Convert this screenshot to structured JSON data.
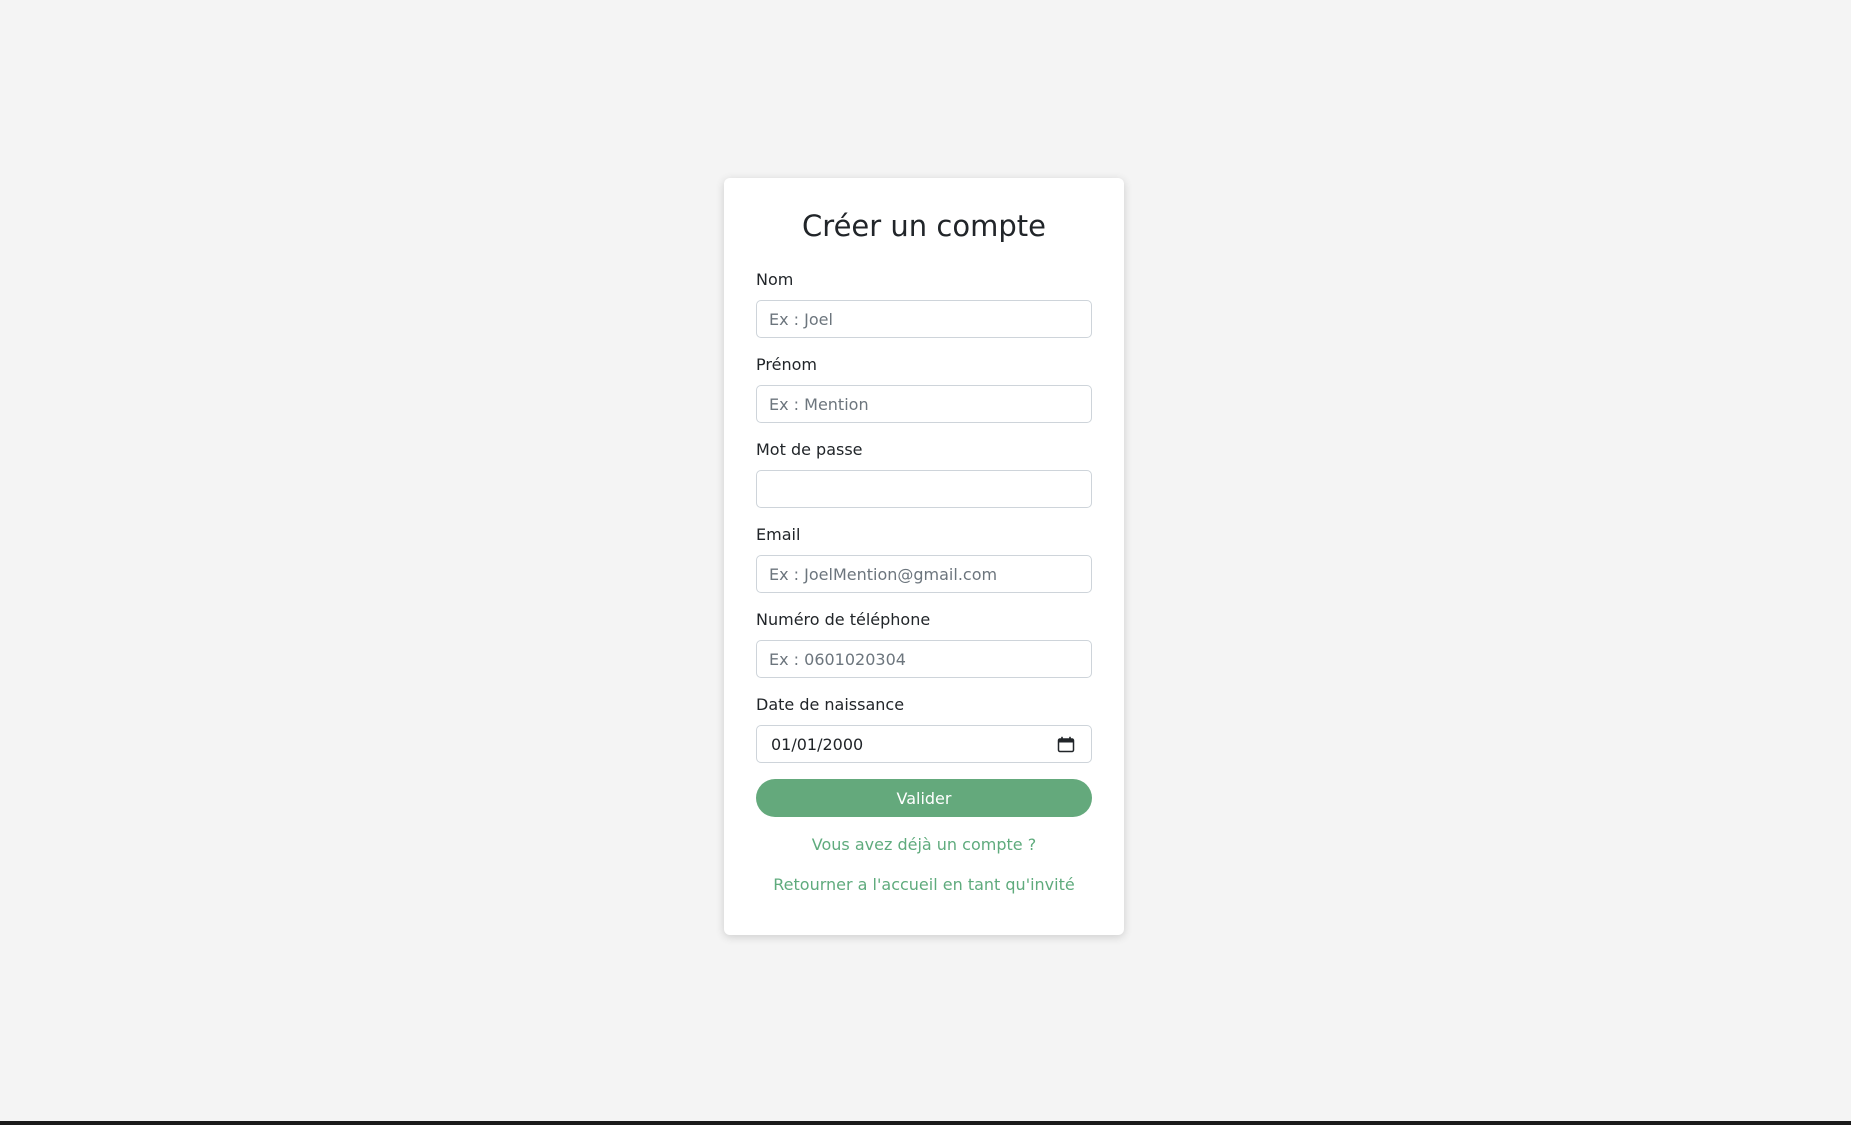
{
  "form": {
    "title": "Créer un compte",
    "fields": {
      "nom": {
        "label": "Nom",
        "placeholder": "Ex : Joel",
        "value": ""
      },
      "prenom": {
        "label": "Prénom",
        "placeholder": "Ex : Mention",
        "value": ""
      },
      "password": {
        "label": "Mot de passe",
        "placeholder": "",
        "value": ""
      },
      "email": {
        "label": "Email",
        "placeholder": "Ex : JoelMention@gmail.com",
        "value": ""
      },
      "phone": {
        "label": "Numéro de téléphone",
        "placeholder": "Ex : 0601020304",
        "value": ""
      },
      "birthdate": {
        "label": "Date de naissance",
        "value": "01/01/2000",
        "icon": "calendar-icon"
      }
    },
    "submit_label": "Valider",
    "login_link": "Vous avez déjà un compte ?",
    "guest_link": "Retourner a l'accueil en tant qu'invité"
  },
  "colors": {
    "background": "#f4f4f4",
    "accent": "#64a97c",
    "link": "#5fab7d"
  }
}
